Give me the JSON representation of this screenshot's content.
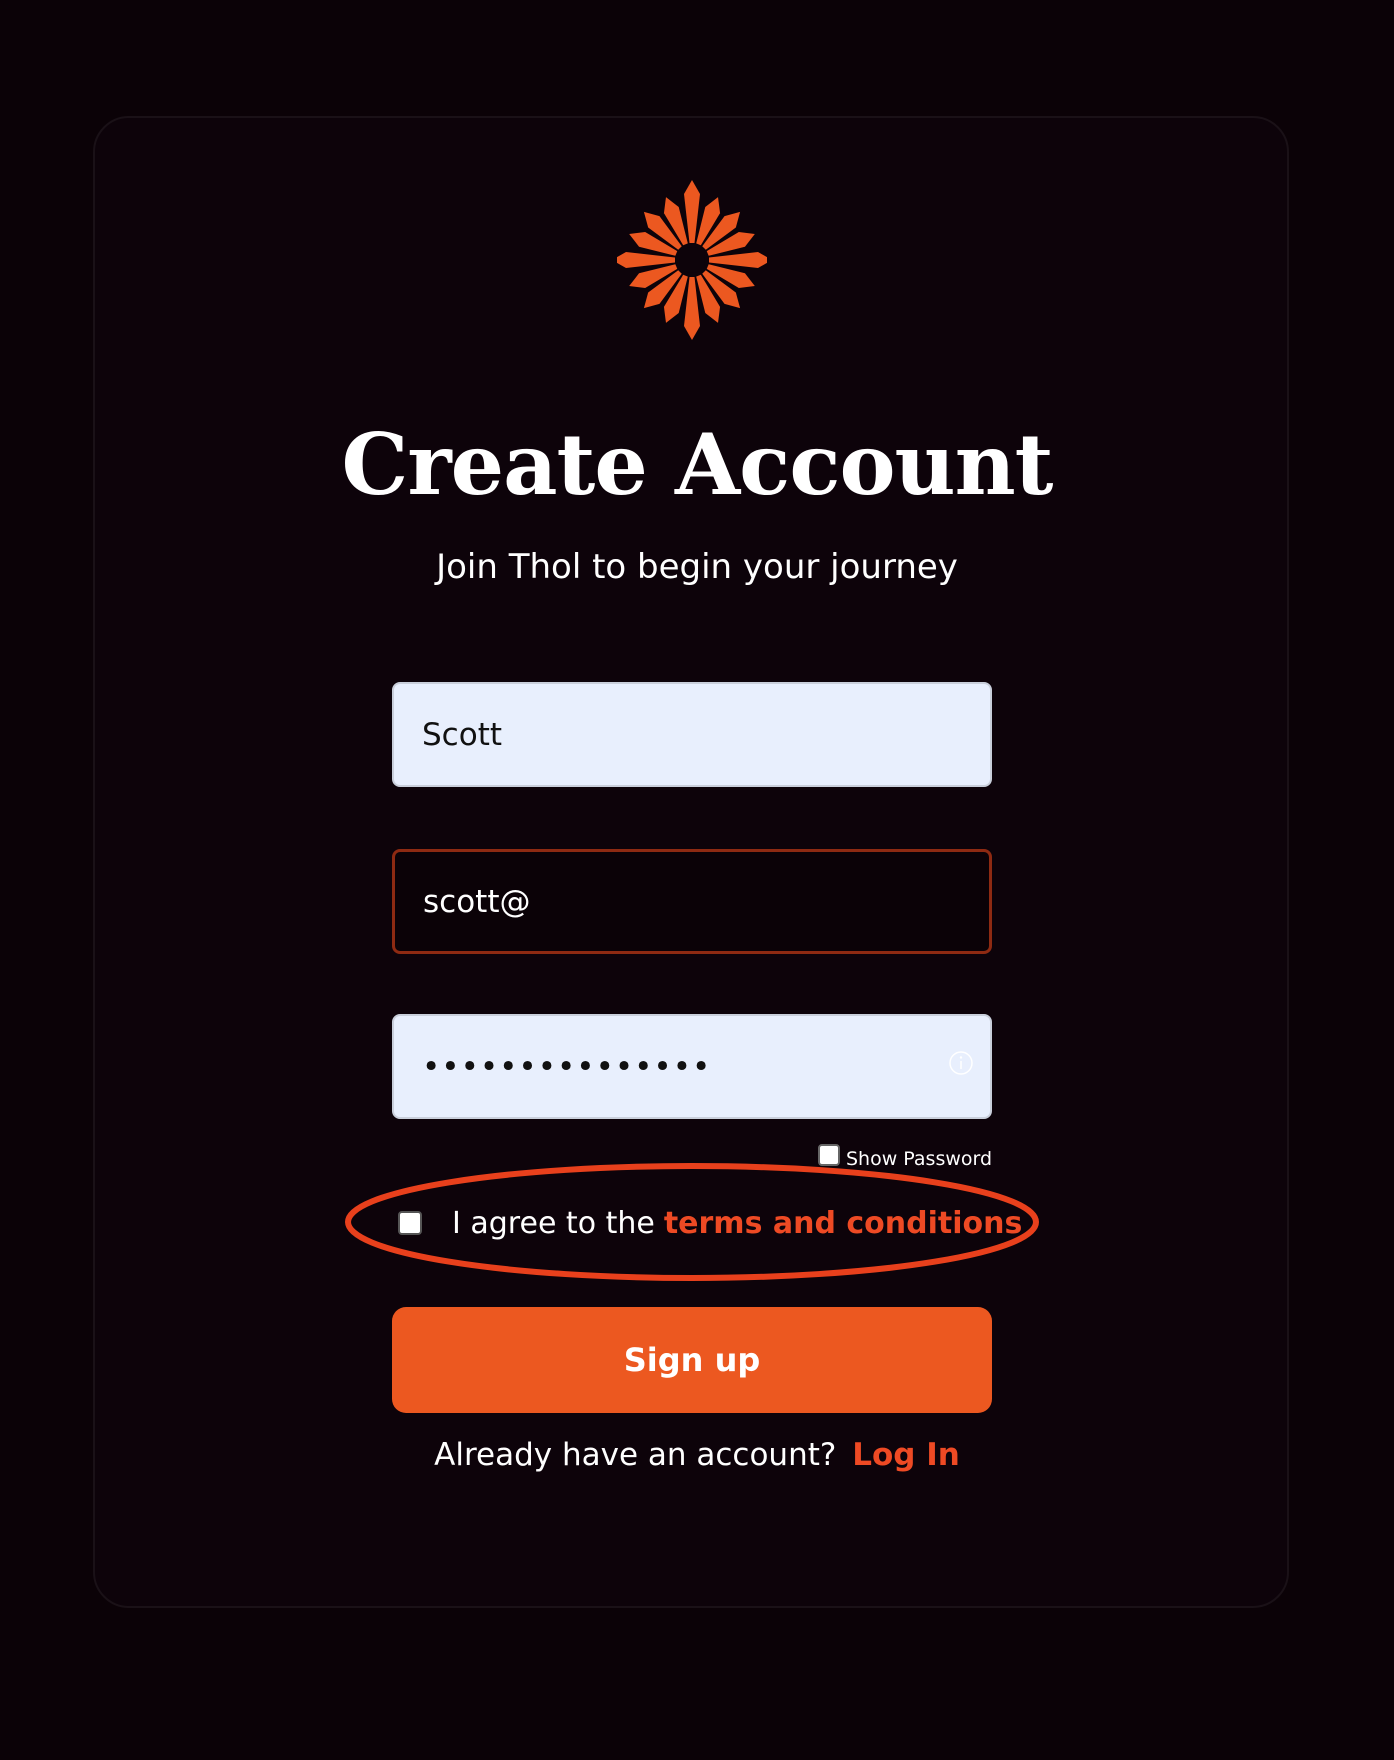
{
  "header": {
    "logo": "thol-starburst-logo",
    "title": "Create Account",
    "subtitle": "Join Thol to begin your journey"
  },
  "form": {
    "name_value": "Scott",
    "email_value": "scott@",
    "password_value": "•••••••••••••••",
    "password_icon": "info-icon",
    "show_password_label": "Show Password",
    "show_password_checked": false,
    "terms_prefix": "I agree to the",
    "terms_link": "terms and conditions",
    "terms_checked": false,
    "submit_label": "Sign up"
  },
  "footer": {
    "prompt": "Already have an account?",
    "login_link": "Log In"
  },
  "colors": {
    "background": "#0b0207",
    "accent": "#ec5820",
    "link": "#ee4a24",
    "input_fill": "#e8effd",
    "error_border": "#8e2a12",
    "annotation": "#e8401c"
  }
}
